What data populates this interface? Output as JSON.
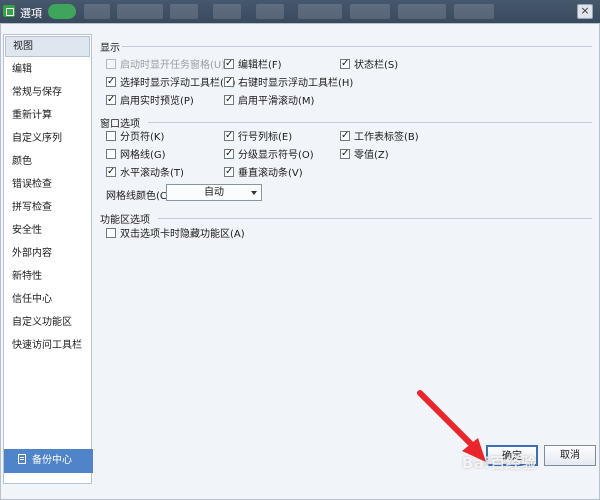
{
  "window": {
    "title": "選項",
    "close_label": "×"
  },
  "sidebar": {
    "items": [
      {
        "label": "视图"
      },
      {
        "label": "编辑"
      },
      {
        "label": "常规与保存"
      },
      {
        "label": "重新计算"
      },
      {
        "label": "自定义序列"
      },
      {
        "label": "颜色"
      },
      {
        "label": "错误检查"
      },
      {
        "label": "拼写检查"
      },
      {
        "label": "安全性"
      },
      {
        "label": "外部内容"
      },
      {
        "label": "新特性"
      },
      {
        "label": "信任中心"
      },
      {
        "label": "自定义功能区"
      },
      {
        "label": "快速访问工具栏"
      }
    ],
    "active_index": 0,
    "backup_label": "备份中心"
  },
  "display": {
    "title": "显示",
    "options": [
      {
        "label": "启动时显开任务窗格(U)",
        "checked": false,
        "disabled": true
      },
      {
        "label": "编辑栏(F)",
        "checked": true,
        "disabled": false
      },
      {
        "label": "状态栏(S)",
        "checked": true,
        "disabled": false
      },
      {
        "label": "选择时显示浮动工具栏(D)",
        "checked": true,
        "disabled": false
      },
      {
        "label": "右键时显示浮动工具栏(H)",
        "checked": true,
        "disabled": false
      },
      {
        "label": "启用实时预览(P)",
        "checked": true,
        "disabled": false
      },
      {
        "label": "启用平滑滚动(M)",
        "checked": true,
        "disabled": false
      }
    ]
  },
  "window_options": {
    "title": "窗口选项",
    "options": [
      {
        "label": "分页符(K)",
        "checked": false
      },
      {
        "label": "行号列标(E)",
        "checked": true
      },
      {
        "label": "工作表标签(B)",
        "checked": true
      },
      {
        "label": "网格线(G)",
        "checked": false
      },
      {
        "label": "分级显示符号(O)",
        "checked": true
      },
      {
        "label": "零值(Z)",
        "checked": true
      },
      {
        "label": "水平滚动条(T)",
        "checked": true
      },
      {
        "label": "垂直滚动条(V)",
        "checked": true
      }
    ],
    "grid_color_label": "网格线颜色(C):",
    "grid_color_value": "自动"
  },
  "ribbon": {
    "title": "功能区选项",
    "options": [
      {
        "label": "双击选项卡时隐藏功能区(A)",
        "checked": false
      }
    ]
  },
  "footer": {
    "ok_label": "确定",
    "cancel_label": "取消"
  },
  "overlay": {
    "arrow_color": "#e8262b",
    "watermark": "Bai百经验"
  }
}
